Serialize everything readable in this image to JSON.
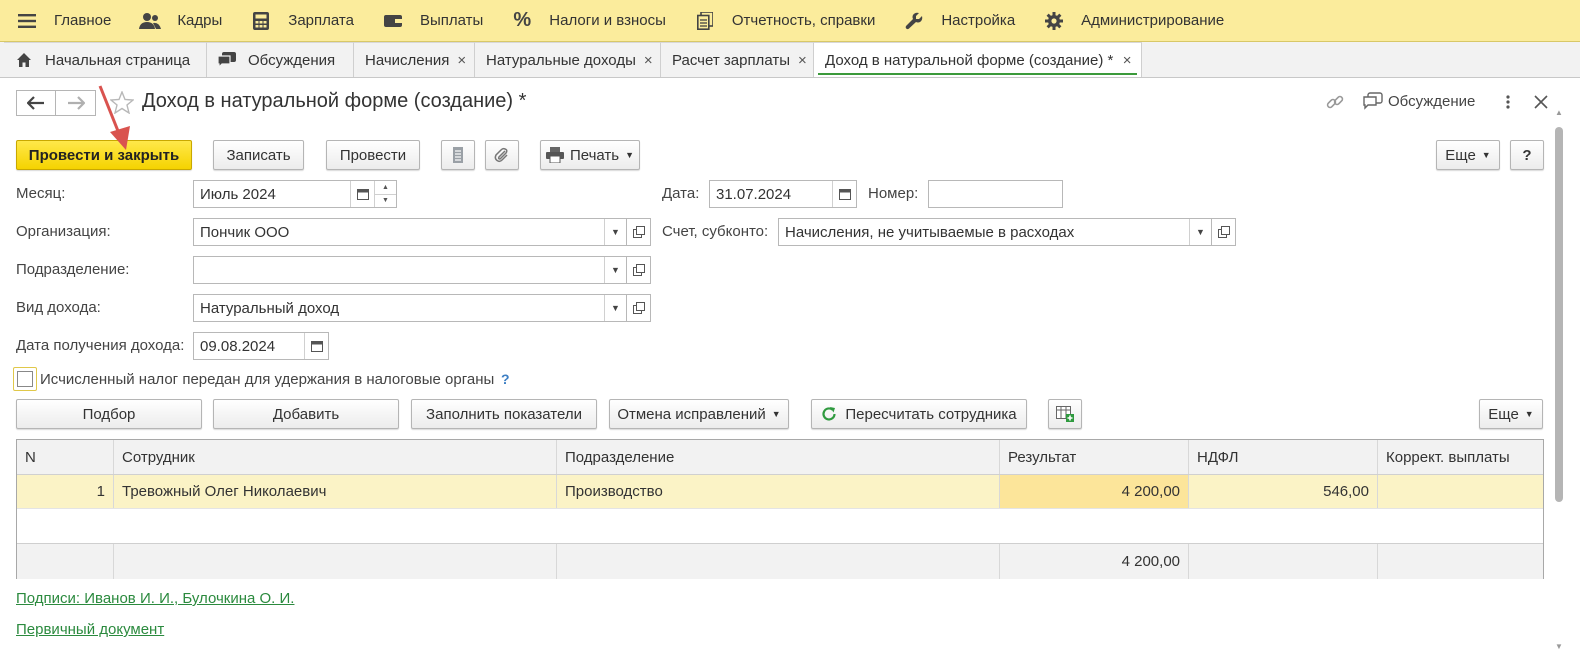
{
  "menu": [
    {
      "label": "Главное",
      "icon": "hamburger-icon"
    },
    {
      "label": "Кадры",
      "icon": "people-icon"
    },
    {
      "label": "Зарплата",
      "icon": "calculator-icon"
    },
    {
      "label": "Выплаты",
      "icon": "wallet-icon"
    },
    {
      "label": "Налоги и взносы",
      "icon": "percent-icon"
    },
    {
      "label": "Отчетность, справки",
      "icon": "documents-icon"
    },
    {
      "label": "Настройка",
      "icon": "wrench-icon"
    },
    {
      "label": "Администрирование",
      "icon": "gear-icon"
    }
  ],
  "tabs": [
    {
      "label": "Начальная страница",
      "icon": "home-icon"
    },
    {
      "label": "Обсуждения",
      "icon": "chat-icon"
    },
    {
      "label": "Начисления",
      "close": "×"
    },
    {
      "label": "Натуральные доходы",
      "close": "×"
    },
    {
      "label": "Расчет зарплаты",
      "close": "×"
    },
    {
      "label": "Доход в натуральной форме (создание) *",
      "close": "×"
    }
  ],
  "window": {
    "title": "Доход в натуральной форме (создание) *",
    "discussion": "Обсуждение"
  },
  "toolbar": {
    "post_close": "Провести и закрыть",
    "save": "Записать",
    "post": "Провести",
    "print": "Печать",
    "more": "Еще",
    "help": "?"
  },
  "form": {
    "month_label": "Месяц:",
    "month_value": "Июль 2024",
    "date_label": "Дата:",
    "date_value": "31.07.2024",
    "number_label": "Номер:",
    "number_value": "",
    "org_label": "Организация:",
    "org_value": "Пончик ООО",
    "account_label": "Счет, субконто:",
    "account_value": "Начисления, не учитываемые в расходах",
    "dept_label": "Подразделение:",
    "dept_value": "",
    "income_type_label": "Вид дохода:",
    "income_type_value": "Натуральный доход",
    "income_date_label": "Дата получения дохода:",
    "income_date_value": "09.08.2024",
    "tax_checkbox_label": "Исчисленный налог передан для удержания в налоговые органы",
    "help_mark": "?"
  },
  "table_toolbar": {
    "select": "Подбор",
    "add": "Добавить",
    "fill": "Заполнить показатели",
    "cancel_fix": "Отмена исправлений",
    "recalc": "Пересчитать сотрудника",
    "more": "Еще"
  },
  "table": {
    "columns": [
      "N",
      "Сотрудник",
      "Подразделение",
      "Результат",
      "НДФЛ",
      "Коррект. выплаты"
    ],
    "rows": [
      {
        "n": "1",
        "employee": "Тревожный Олег Николаевич",
        "dept": "Производство",
        "result": "4 200,00",
        "ndfl": "546,00",
        "correction": ""
      }
    ],
    "footer": {
      "result": "4 200,00"
    }
  },
  "links": {
    "signatures": "Подписи: Иванов И. И., Булочкина О. И.",
    "primary_doc": "Первичный документ"
  },
  "colors": {
    "menu_bg": "#fbec9c",
    "primary_button": "#f5d300",
    "active_tab_underline": "#3b9a3b",
    "link": "#2b8a3e",
    "selected_row": "#fbf3c6",
    "result_cell": "#fce59a",
    "annotation_arrow": "#d9534f"
  }
}
